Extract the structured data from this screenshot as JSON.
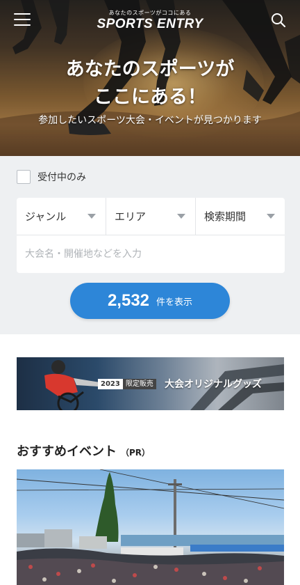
{
  "header": {
    "logo_tagline": "あなたのスポーツがココにある",
    "logo_name": "SPORTS ENTRY",
    "menu_icon": "hamburger-menu-icon",
    "search_icon": "search-icon"
  },
  "hero": {
    "title_line1": "あなたのスポーツが",
    "title_line2": "ここにある！",
    "subtitle": "参加したいスポーツ大会・イベントが見つかります"
  },
  "search": {
    "accepting_only_label": "受付中のみ",
    "genre_label": "ジャンル",
    "area_label": "エリア",
    "period_label": "検索期間",
    "keyword_placeholder": "大会名・開催地などを入力",
    "result_count": "2,532",
    "result_suffix": "件を表示"
  },
  "banner": {
    "year": "2023",
    "limited": "限定販売",
    "text": "大会オリジナルグッズ"
  },
  "recommended": {
    "title": "おすすめイベント",
    "pr": "（PR）"
  },
  "colors": {
    "accent_blue": "#2d86d8",
    "panel_bg": "#eef0f2"
  }
}
